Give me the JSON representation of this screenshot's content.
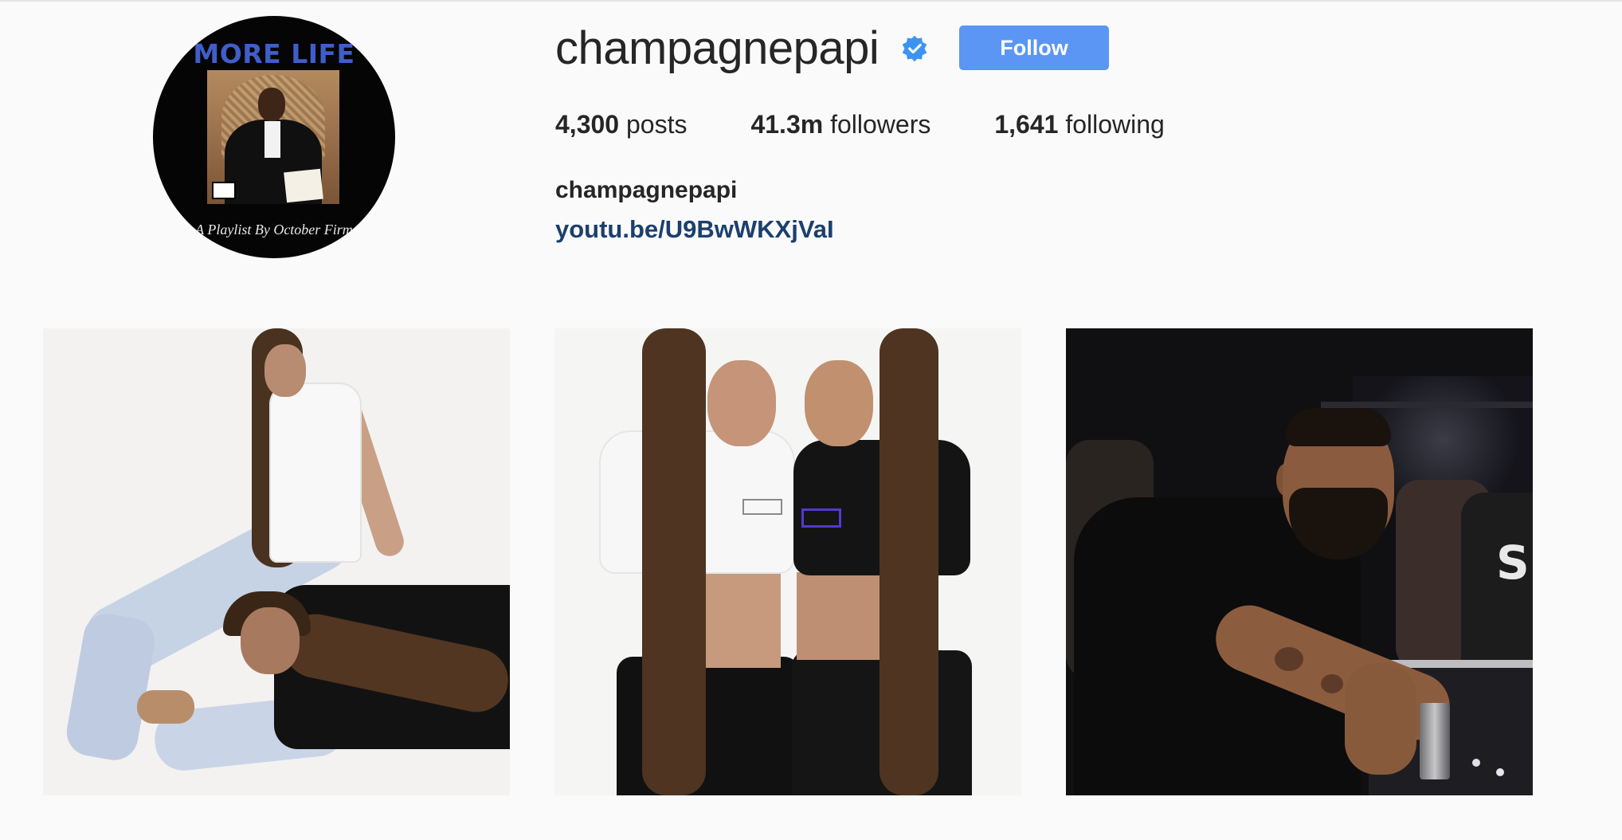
{
  "profile": {
    "avatar": {
      "album_title": "MORE LIFE",
      "album_subtitle": "A Playlist By October Firm"
    },
    "username": "champagnepapi",
    "verified_icon": "verified-badge-icon",
    "follow_label": "Follow",
    "stats": {
      "posts_count": "4,300",
      "posts_label": "posts",
      "followers_count": "41.3m",
      "followers_label": "followers",
      "following_count": "1,641",
      "following_label": "following"
    },
    "full_name": "champagnepapi",
    "bio_link": "youtu.be/U9BwWKXjVaI"
  },
  "posts": [
    {
      "subject": "two-women-posing-on-floor-photo"
    },
    {
      "subject": "two-women-in-ovo-crop-tops-photo"
    },
    {
      "subject": "man-at-dj-booth-photo"
    }
  ],
  "colors": {
    "background": "#fafafa",
    "follow_button": "#5b96f4",
    "verified_badge": "#3b94ef",
    "link": "#1c3f6e",
    "text": "#262626"
  }
}
